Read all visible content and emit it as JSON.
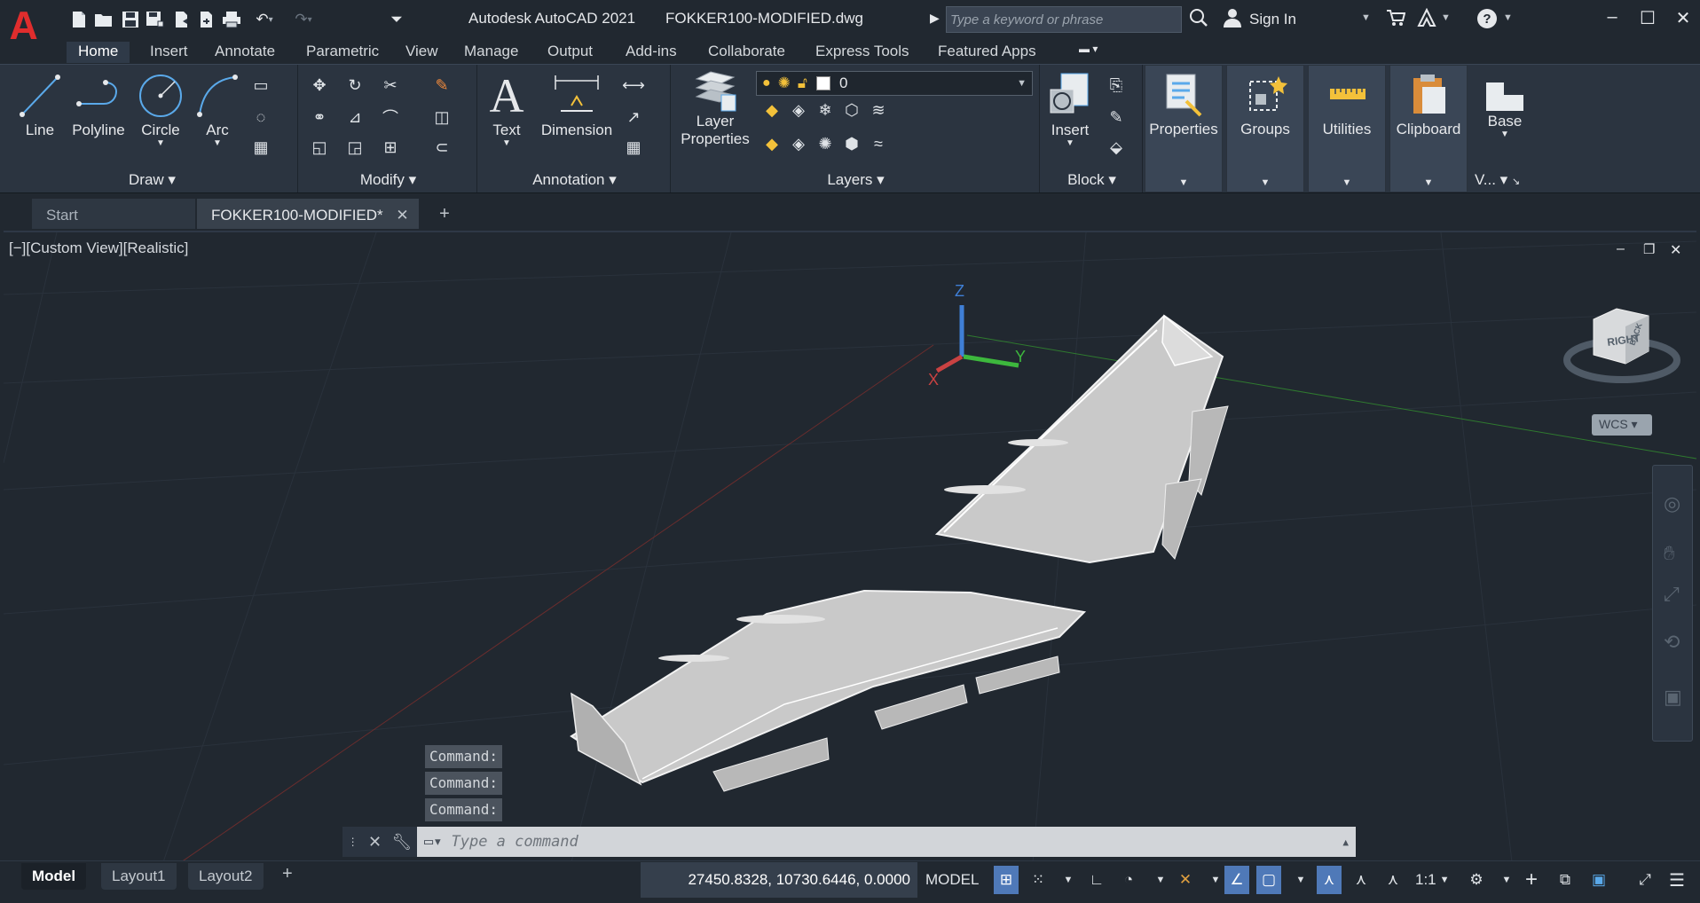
{
  "app": {
    "title": "Autodesk AutoCAD 2021",
    "filename": "FOKKER100-MODIFIED.dwg",
    "logo_letter": "A",
    "accent": "#e02d2d"
  },
  "titlebar": {
    "search_placeholder": "Type a keyword or phrase",
    "sign_in": "Sign In",
    "quick_access_icons": [
      "new-icon",
      "open-icon",
      "save-icon",
      "saveas-icon",
      "open-web-icon",
      "save-web-icon",
      "plot-icon",
      "undo-icon",
      "redo-icon",
      "customize-icon"
    ]
  },
  "ribbon_tabs": [
    "Home",
    "Insert",
    "Annotate",
    "Parametric",
    "View",
    "Manage",
    "Output",
    "Add-ins",
    "Collaborate",
    "Express Tools",
    "Featured Apps"
  ],
  "ribbon": {
    "draw": {
      "label": "Draw",
      "line": "Line",
      "polyline": "Polyline",
      "circle": "Circle",
      "arc": "Arc"
    },
    "modify": {
      "label": "Modify"
    },
    "annotation": {
      "label": "Annotation",
      "text": "Text",
      "dimension": "Dimension"
    },
    "layers": {
      "label": "Layers",
      "layer_properties_1": "Layer",
      "layer_properties_2": "Properties",
      "current_layer": "0"
    },
    "block": {
      "label": "Block",
      "insert": "Insert"
    },
    "properties": {
      "label": "Properties"
    },
    "groups": {
      "label": "Groups"
    },
    "utilities": {
      "label": "Utilities"
    },
    "clipboard": {
      "label": "Clipboard"
    },
    "view": {
      "base": "Base",
      "label": "V..."
    }
  },
  "doc_tabs": {
    "start": "Start",
    "active": "FOKKER100-MODIFIED*"
  },
  "viewport": {
    "label": "[−][Custom View][Realistic]",
    "viewcube_face": "RIGHT",
    "viewcube_back": "BACK",
    "wcs": "WCS",
    "axis_x": "X",
    "axis_y": "Y",
    "axis_z": "Z"
  },
  "command": {
    "history": [
      "Command:",
      "Command:",
      "Command:"
    ],
    "placeholder": "Type a command"
  },
  "layout_tabs": [
    "Model",
    "Layout1",
    "Layout2"
  ],
  "status": {
    "coordinates": "27450.8328, 10730.6446, 0.0000",
    "space": "MODEL",
    "scale": "1:1"
  }
}
